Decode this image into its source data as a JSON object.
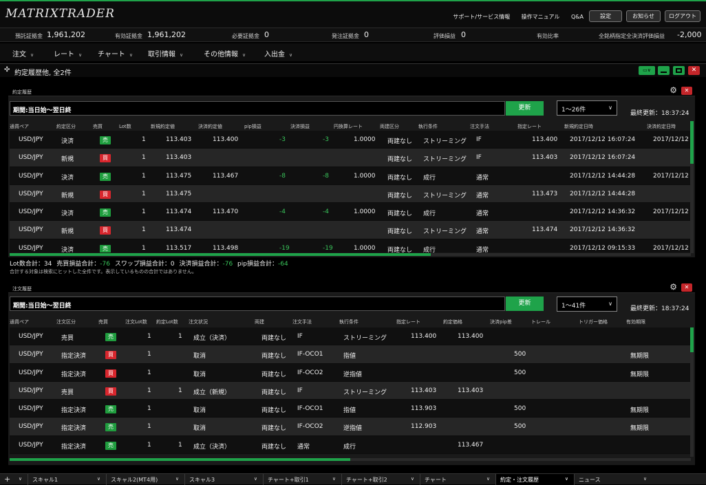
{
  "header": {
    "logo": "MATRIXTRADER",
    "links": [
      "サポート/サービス情報",
      "操作マニュアル",
      "Q&A"
    ],
    "buttons": [
      "設定",
      "お知らせ",
      "ログアウト"
    ]
  },
  "account": [
    {
      "label": "預託証拠金",
      "value": "1,961,202"
    },
    {
      "label": "有効証拠金",
      "value": "1,961,202"
    },
    {
      "label": "必要証拠金",
      "value": "0"
    },
    {
      "label": "発注証拠金",
      "value": "0"
    },
    {
      "label": "評価損益",
      "value": "0"
    },
    {
      "label": "有効比率",
      "value": ""
    },
    {
      "label": "全銘柄指定全決済評価損益",
      "value": "-2,000"
    }
  ],
  "menu": [
    "注文",
    "レート",
    "チャート",
    "取引情報",
    "その他情報",
    "入出金"
  ],
  "panel": {
    "title": "約定履歴他, 全2件"
  },
  "execution": {
    "title": "約定履歴",
    "filter": "期間:当日始～翌日終",
    "update_label": "更新",
    "range": "1～26件",
    "last_update": "最終更新：18:37:24",
    "columns": [
      "通貨ペア",
      "約定区分",
      "売買",
      "Lot数",
      "新規約定値",
      "決済約定値",
      "pip損益",
      "決済損益",
      "円換算レート",
      "両建区分",
      "執行条件",
      "注文手法",
      "指定レート",
      "新規約定日時",
      "決済約定日時"
    ],
    "rows": [
      {
        "pair": "USD/JPY",
        "kind": "決済",
        "side": "売",
        "lot": "1",
        "open": "113.403",
        "close": "113.400",
        "pip": "-3",
        "pl": "-3",
        "rate": "1.0000",
        "hedge": "両建なし",
        "cond": "ストリーミング",
        "method": "IF",
        "spec": "113.400",
        "opentime": "2017/12/12 16:07:24",
        "closetime": "2017/12/12"
      },
      {
        "pair": "USD/JPY",
        "kind": "新規",
        "side": "買",
        "lot": "1",
        "open": "113.403",
        "close": "",
        "pip": "",
        "pl": "",
        "rate": "",
        "hedge": "両建なし",
        "cond": "ストリーミング",
        "method": "IF",
        "spec": "113.403",
        "opentime": "2017/12/12 16:07:24",
        "closetime": ""
      },
      {
        "pair": "USD/JPY",
        "kind": "決済",
        "side": "売",
        "lot": "1",
        "open": "113.475",
        "close": "113.467",
        "pip": "-8",
        "pl": "-8",
        "rate": "1.0000",
        "hedge": "両建なし",
        "cond": "成行",
        "method": "通常",
        "spec": "",
        "opentime": "2017/12/12 14:44:28",
        "closetime": "2017/12/12"
      },
      {
        "pair": "USD/JPY",
        "kind": "新規",
        "side": "買",
        "lot": "1",
        "open": "113.475",
        "close": "",
        "pip": "",
        "pl": "",
        "rate": "",
        "hedge": "両建なし",
        "cond": "ストリーミング",
        "method": "通常",
        "spec": "113.473",
        "opentime": "2017/12/12 14:44:28",
        "closetime": ""
      },
      {
        "pair": "USD/JPY",
        "kind": "決済",
        "side": "売",
        "lot": "1",
        "open": "113.474",
        "close": "113.470",
        "pip": "-4",
        "pl": "-4",
        "rate": "1.0000",
        "hedge": "両建なし",
        "cond": "成行",
        "method": "通常",
        "spec": "",
        "opentime": "2017/12/12 14:36:32",
        "closetime": "2017/12/12"
      },
      {
        "pair": "USD/JPY",
        "kind": "新規",
        "side": "買",
        "lot": "1",
        "open": "113.474",
        "close": "",
        "pip": "",
        "pl": "",
        "rate": "",
        "hedge": "両建なし",
        "cond": "ストリーミング",
        "method": "通常",
        "spec": "113.474",
        "opentime": "2017/12/12 14:36:32",
        "closetime": ""
      },
      {
        "pair": "USD/JPY",
        "kind": "決済",
        "side": "売",
        "lot": "1",
        "open": "113.517",
        "close": "113.498",
        "pip": "-19",
        "pl": "-19",
        "rate": "1.0000",
        "hedge": "両建なし",
        "cond": "成行",
        "method": "通常",
        "spec": "",
        "opentime": "2017/12/12 09:15:33",
        "closetime": "2017/12/12"
      }
    ],
    "summary": [
      {
        "label": "Lot数合計：",
        "value": "34"
      },
      {
        "label": "売買損益合計：",
        "value": "-76"
      },
      {
        "label": "スワップ損益合計：",
        "value": "0"
      },
      {
        "label": "決済損益合計：",
        "value": "-76"
      },
      {
        "label": "pip損益合計：",
        "value": "-64"
      }
    ],
    "note": "合計する対象は検索にヒットした全件です。表示しているものの合計ではありません。"
  },
  "orders": {
    "title": "注文履歴",
    "filter": "期間:当日始～翌日終",
    "update_label": "更新",
    "range": "1～41件",
    "last_update": "最終更新：18:37:24",
    "columns": [
      "通貨ペア",
      "注文区分",
      "売買",
      "注文Lot数",
      "約定Lot数",
      "注文状況",
      "両建",
      "注文手法",
      "執行条件",
      "指定レート",
      "約定価格",
      "決済pip差",
      "トレール",
      "トリガー価格",
      "有効期限"
    ],
    "rows": [
      {
        "pair": "USD/JPY",
        "kind": "売買",
        "side": "売",
        "olot": "1",
        "elot": "1",
        "status": "成立（決済）",
        "hedge": "両建なし",
        "method": "IF",
        "cond": "ストリーミング",
        "spec": "113.400",
        "price": "113.400",
        "pipdiff": "",
        "expiry": ""
      },
      {
        "pair": "USD/JPY",
        "kind": "指定決済",
        "side": "買",
        "olot": "1",
        "elot": "",
        "status": "取消",
        "hedge": "両建なし",
        "method": "IF-OCO1",
        "cond": "指値",
        "spec": "",
        "price": "",
        "pipdiff": "500",
        "expiry": "無期限"
      },
      {
        "pair": "USD/JPY",
        "kind": "指定決済",
        "side": "買",
        "olot": "1",
        "elot": "",
        "status": "取消",
        "hedge": "両建なし",
        "method": "IF-OCO2",
        "cond": "逆指値",
        "spec": "",
        "price": "",
        "pipdiff": "500",
        "expiry": "無期限"
      },
      {
        "pair": "USD/JPY",
        "kind": "売買",
        "side": "買",
        "olot": "1",
        "elot": "1",
        "status": "成立（新規）",
        "hedge": "両建なし",
        "method": "IF",
        "cond": "ストリーミング",
        "spec": "113.403",
        "price": "113.403",
        "pipdiff": "",
        "expiry": ""
      },
      {
        "pair": "USD/JPY",
        "kind": "指定決済",
        "side": "売",
        "olot": "1",
        "elot": "",
        "status": "取消",
        "hedge": "両建なし",
        "method": "IF-OCO1",
        "cond": "指値",
        "spec": "113.903",
        "price": "",
        "pipdiff": "500",
        "expiry": "無期限"
      },
      {
        "pair": "USD/JPY",
        "kind": "指定決済",
        "side": "売",
        "olot": "1",
        "elot": "",
        "status": "取消",
        "hedge": "両建なし",
        "method": "IF-OCO2",
        "cond": "逆指値",
        "spec": "112.903",
        "price": "",
        "pipdiff": "500",
        "expiry": "無期限"
      },
      {
        "pair": "USD/JPY",
        "kind": "指定決済",
        "side": "売",
        "olot": "1",
        "elot": "1",
        "status": "成立（決済）",
        "hedge": "両建なし",
        "method": "通常",
        "cond": "成行",
        "spec": "",
        "price": "113.467",
        "pipdiff": "",
        "expiry": ""
      }
    ]
  },
  "tabs": [
    "スキャル1",
    "スキャル2(MT4用)",
    "スキャル3",
    "チャート+取引1",
    "チャート+取引2",
    "チャート",
    "約定・注文履歴",
    "ニュース"
  ],
  "active_tab": "約定・注文履歴",
  "colors": {
    "accent": "#1fa34a",
    "sell": "#1f9d3e",
    "buy": "#d8262d"
  }
}
